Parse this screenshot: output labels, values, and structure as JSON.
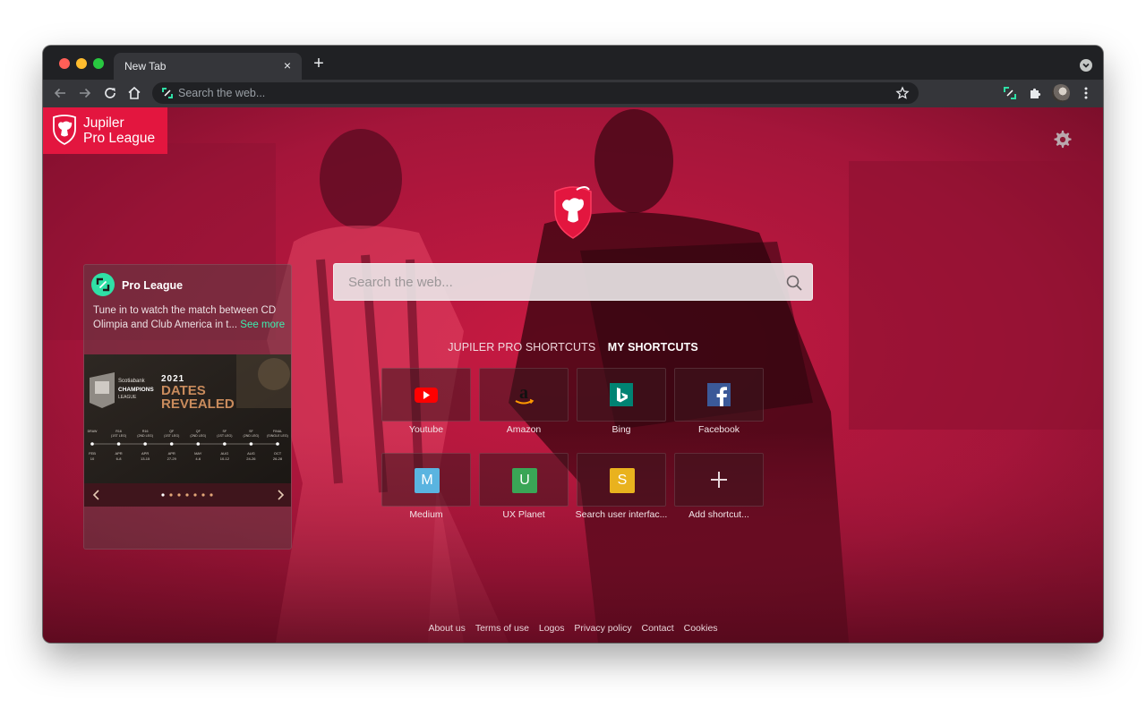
{
  "browser": {
    "tab_title": "New Tab",
    "tab_close": "×",
    "new_tab": "+",
    "omnibox_placeholder": "Search the web..."
  },
  "brand": {
    "line1": "Jupiler",
    "line2": "Pro League",
    "color": "#e3163f"
  },
  "search": {
    "placeholder": "Search the web..."
  },
  "shortcut_tabs": [
    {
      "label": "JUPILER PRO SHORTCUTS",
      "active": false
    },
    {
      "label": "MY SHORTCUTS",
      "active": true
    }
  ],
  "shortcuts": [
    {
      "label": "Youtube",
      "icon": "youtube-icon"
    },
    {
      "label": "Amazon",
      "icon": "amazon-icon"
    },
    {
      "label": "Bing",
      "icon": "bing-icon"
    },
    {
      "label": "Facebook",
      "icon": "facebook-icon"
    },
    {
      "label": "Medium",
      "icon": "letter-m-icon",
      "letter": "M",
      "color": "#5ab4e0"
    },
    {
      "label": "UX Planet",
      "icon": "letter-u-icon",
      "letter": "U",
      "color": "#3aa556"
    },
    {
      "label": "Search user interfac...",
      "icon": "letter-s-icon",
      "letter": "S",
      "color": "#e9b21e"
    },
    {
      "label": "Add shortcut...",
      "icon": "plus-icon"
    }
  ],
  "news": {
    "source": "Pro League",
    "text_line1": "Tune in to watch the match between CD",
    "text_line2": "Olimpia and Club America in t...",
    "more": "See more",
    "image": {
      "year": "2021",
      "headline1": "DATES",
      "headline2": "REVEALED",
      "brand_small": "Scotiabank",
      "brand_big": "CHAMPIONS",
      "brand_sub": "LEAGUE",
      "timeline": [
        {
          "stage": "DRAW",
          "date1": "FEB",
          "date2": "10"
        },
        {
          "stage": "R16 (1ST LEG)",
          "date1": "APR",
          "date2": "6-8"
        },
        {
          "stage": "R16 (2ND LEG)",
          "date1": "APR",
          "date2": "13-15"
        },
        {
          "stage": "QF (1ST LEG)",
          "date1": "APR",
          "date2": "27-29"
        },
        {
          "stage": "QF (2ND LEG)",
          "date1": "MAY",
          "date2": "4-6"
        },
        {
          "stage": "SF (1ST LEG)",
          "date1": "AUG",
          "date2": "10-12"
        },
        {
          "stage": "SF (2ND LEG)",
          "date1": "AUG",
          "date2": "24-26"
        },
        {
          "stage": "FINAL (SINGLE LEG)",
          "date1": "OCT",
          "date2": "26-28"
        }
      ]
    },
    "carousel_slides": 7,
    "carousel_active": 1
  },
  "footer_links": [
    "About us",
    "Terms of use",
    "Logos",
    "Privacy policy",
    "Contact",
    "Cookies"
  ],
  "colors": {
    "accent_green": "#3bf0b0",
    "page_tint": "#c4173f"
  }
}
